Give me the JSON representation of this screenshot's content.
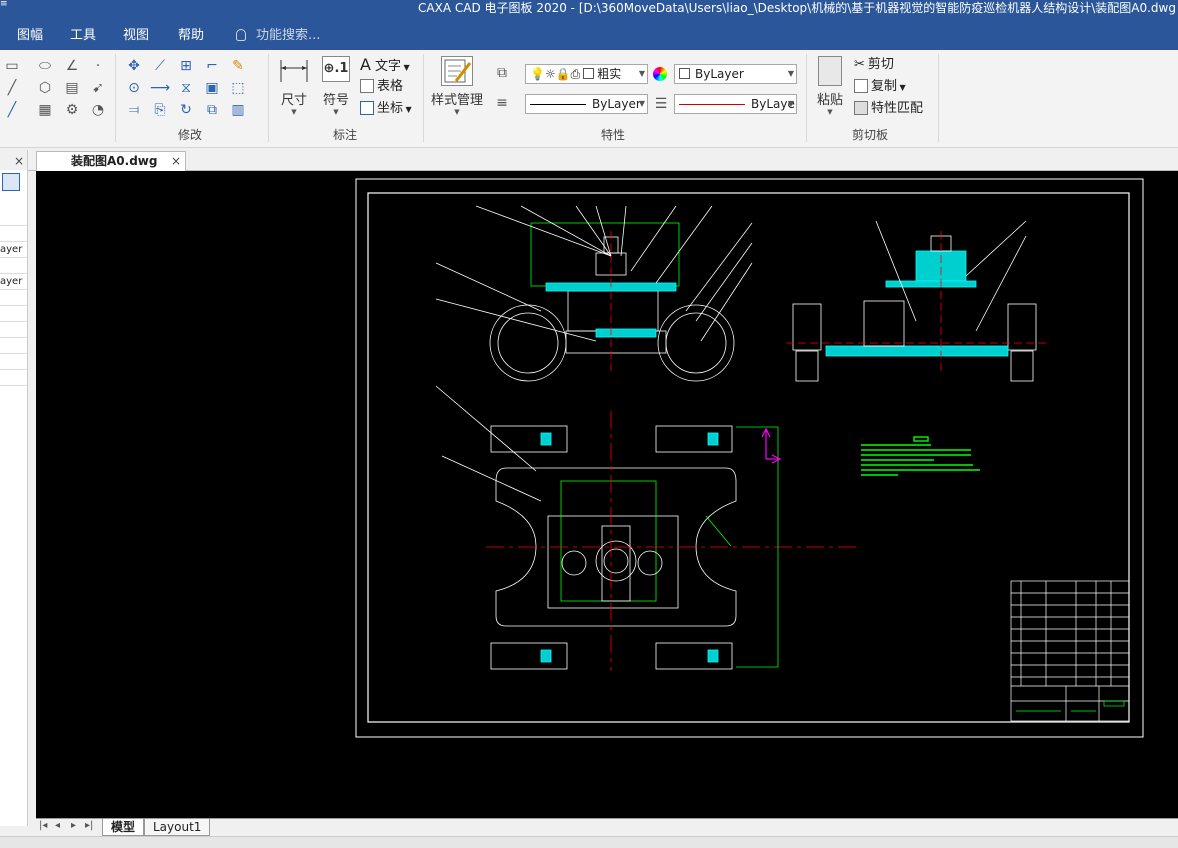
{
  "window": {
    "title": "CAXA CAD 电子图板 2020 - [D:\\360MoveData\\Users\\liao_\\Desktop\\机械的\\基于机器视觉的智能防疫巡检机器人结构设计\\装配图A0.dwg"
  },
  "menu": {
    "items": [
      "图幅",
      "工具",
      "视图",
      "帮助"
    ],
    "search_placeholder": "功能搜索..."
  },
  "ribbon": {
    "groups": {
      "modify": "修改",
      "annotation": "标注",
      "properties": "特性",
      "clipboard": "剪切板"
    },
    "annotation": {
      "dimension": "尺寸",
      "symbol": "符号",
      "text": "文字",
      "table": "表格",
      "coordinate": "坐标"
    },
    "style_manager": "样式管理",
    "properties": {
      "layer_name": "粗实",
      "color": "ByLayer",
      "linetype": "ByLayer",
      "lineweight": "ByLaye"
    },
    "clipboard": {
      "paste": "粘贴",
      "cut": "剪切",
      "copy": "复制",
      "match_properties": "特性匹配"
    }
  },
  "left_panel": {
    "rows": [
      "",
      "",
      "ayer",
      "",
      "ayer",
      "",
      "",
      "",
      "",
      "",
      ""
    ]
  },
  "document": {
    "tab_label": "装配图A0.dwg",
    "close_glyph": "×"
  },
  "layout_tabs": [
    "模型",
    "Layout1"
  ],
  "colors": {
    "titlebar": "#2b579a",
    "canvas": "#000000",
    "drawing_white": "#ffffff",
    "drawing_cyan": "#00ffff",
    "drawing_green": "#00ff00",
    "drawing_red": "#ff0000",
    "drawing_magenta": "#ff00ff"
  }
}
